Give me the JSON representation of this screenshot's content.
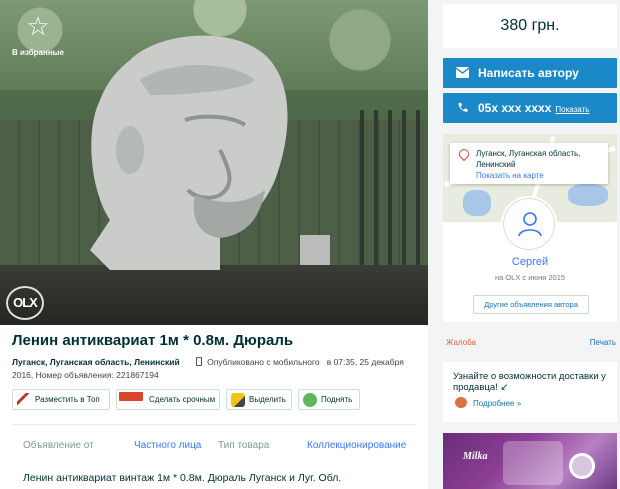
{
  "favorite": {
    "icon": "star-icon",
    "label": "В избранные"
  },
  "listing": {
    "title": "Ленин антиквариат 1м * 0.8м. Дюраль",
    "city": "Луганск, Луганская область, Ленинский",
    "published": "Опубликовано с мобильного",
    "time": "в 07:35, 25 декабря",
    "year_and_id": "2016, Номер объявления: 221867194",
    "description": "Ленин антиквариат винтаж 1м * 0.8м. Дюраль Луганск и Луг. Обл."
  },
  "actions": [
    {
      "label": "Разместить в Топ",
      "icon": "pin-top-icon",
      "color": "#c0392b"
    },
    {
      "label": "Сделать срочным",
      "icon": "urgent-icon",
      "color": "#d8452c"
    },
    {
      "label": "Выделить",
      "icon": "highlight-icon",
      "color": "#f1c40f"
    },
    {
      "label": "Поднять",
      "icon": "refresh-icon",
      "color": "#5cb85c"
    }
  ],
  "details": {
    "offer_from_label": "Объявление от",
    "offer_from_value": "Частного лица",
    "type_label": "Тип товара",
    "type_value": "Коллекционирование"
  },
  "sidebar": {
    "price": "380 грн.",
    "write_label": "Написать автору",
    "phone": "05x xxx xxxx",
    "show_label": "Показать",
    "location_line1": "Луганск, Луганская область,",
    "location_line2": "Ленинский",
    "map_link": "Показать на карте",
    "user_name": "Сергей",
    "since": "на OLX с июня 2015",
    "other_ads": "Другие объявления автора",
    "complaint": "Жалоба",
    "print": "Печать",
    "delivery_text": "Узнайте о возможности доставки у продавца! ↙",
    "delivery_more": "Подробнее »",
    "ad_brand": "Milka"
  },
  "colors": {
    "accent": "#1b88c8",
    "link": "#3a77ff",
    "complaint": "#d9603b"
  }
}
